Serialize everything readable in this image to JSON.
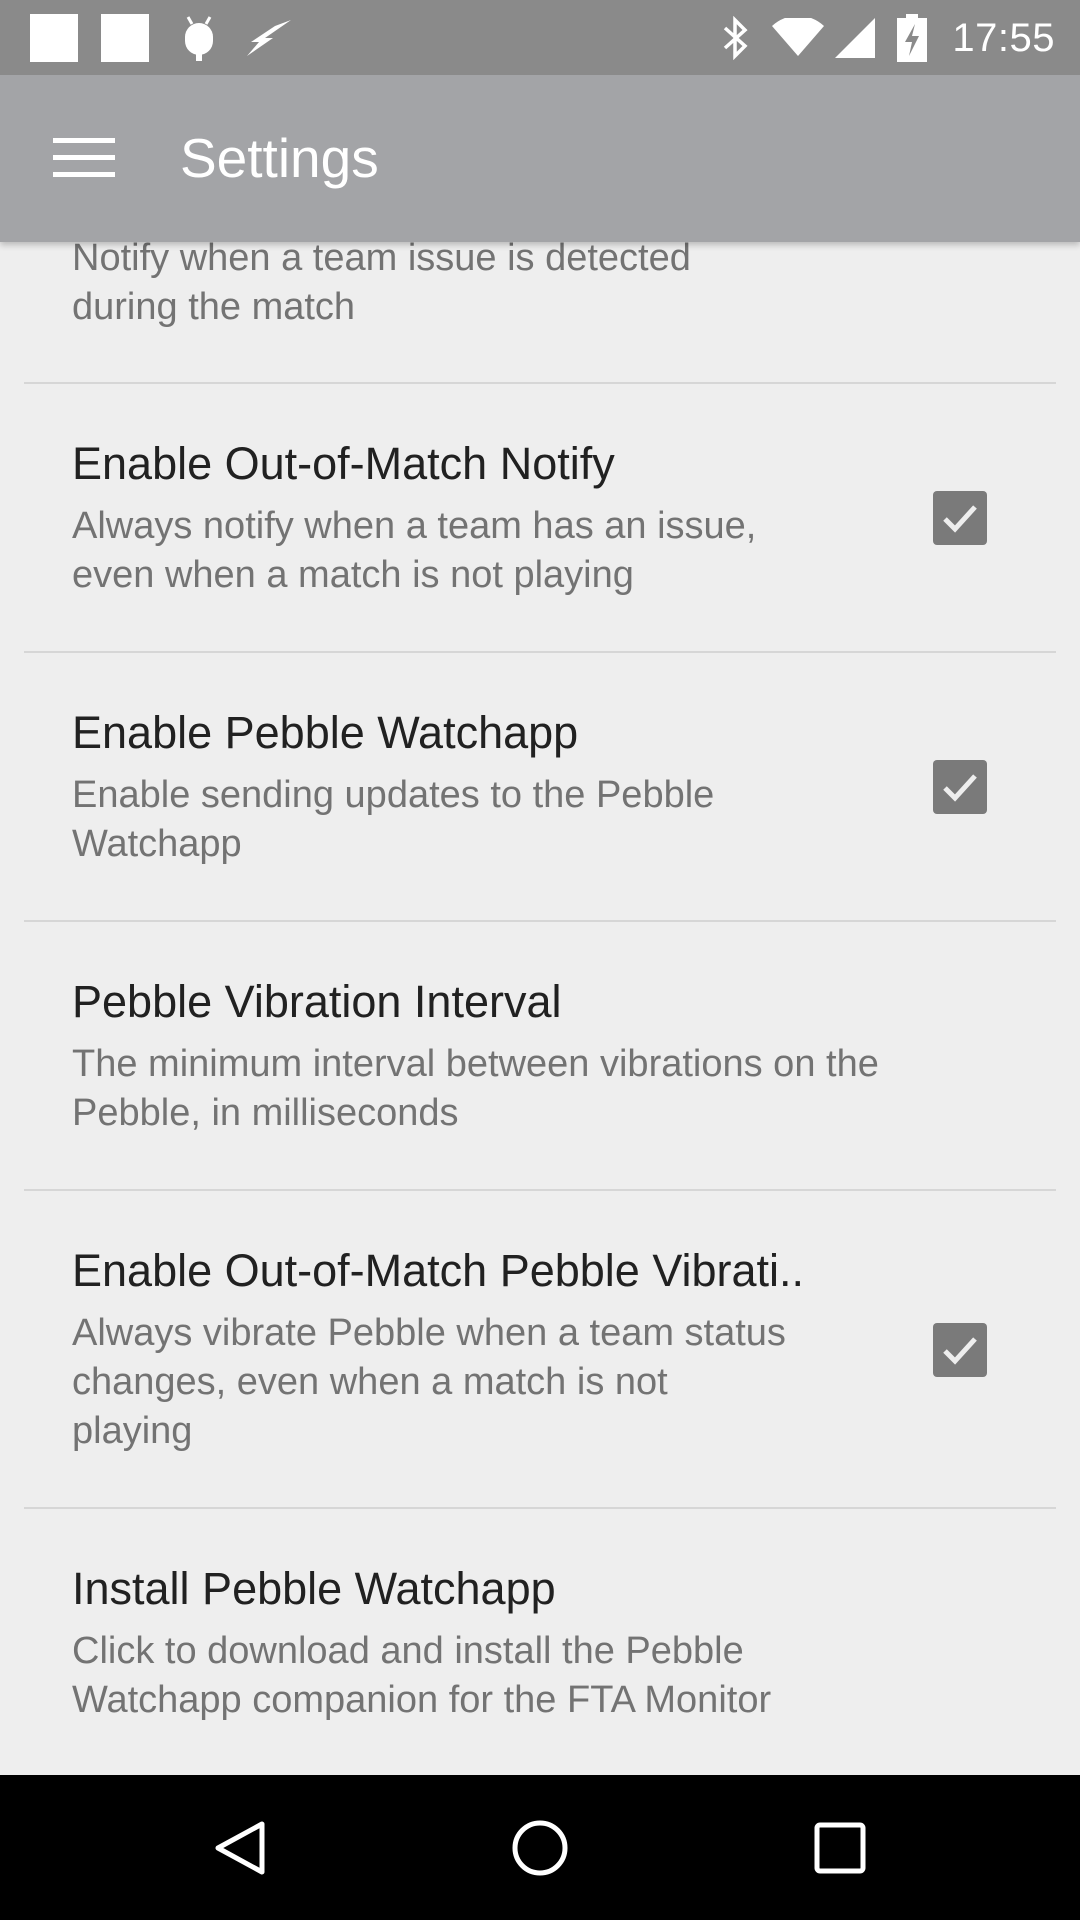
{
  "status_bar": {
    "time": "17:55",
    "left_icons": [
      "notification-square-icon",
      "notification-square-icon",
      "android-debug-icon",
      "lightning-icon"
    ],
    "right_icons": [
      "bluetooth-icon",
      "wifi-icon",
      "cellular-signal-icon",
      "battery-charging-icon"
    ]
  },
  "app_bar": {
    "title": "Settings",
    "menu_icon": "hamburger-menu-icon"
  },
  "preferences": [
    {
      "title": "",
      "summary_lines": [
        "Notify when a team issue is detected",
        "during the match"
      ],
      "checkbox": true,
      "checked": true
    },
    {
      "title": "Enable Out-of-Match Notify",
      "summary_lines": [
        "Always notify when a team has an issue,",
        "even when a match is not playing"
      ],
      "checkbox": true,
      "checked": true
    },
    {
      "title": "Enable Pebble Watchapp",
      "summary_lines": [
        "Enable sending updates to the Pebble",
        "Watchapp"
      ],
      "checkbox": true,
      "checked": true
    },
    {
      "title": "Pebble Vibration Interval",
      "summary_lines": [
        "The minimum interval between vibrations on the",
        "Pebble, in milliseconds"
      ],
      "checkbox": false
    },
    {
      "title": "Enable Out-of-Match Pebble Vibrati..",
      "summary_lines": [
        "Always vibrate Pebble when a team status",
        "changes, even when a match is not",
        "playing"
      ],
      "checkbox": true,
      "checked": true
    },
    {
      "title": "Install Pebble Watchapp",
      "summary_lines": [
        "Click to download and install the Pebble",
        "Watchapp companion for the FTA Monitor"
      ],
      "checkbox": false
    }
  ],
  "nav_bar": {
    "back_icon": "back-triangle-icon",
    "home_icon": "home-circle-icon",
    "recents_icon": "recents-square-icon"
  },
  "colors": {
    "status_bar": "#8a8a8a",
    "app_bar": "#a3a4a7",
    "background": "#eeeeee",
    "checkbox": "#7a7a7a",
    "title_text": "#212121",
    "summary_text": "#737373"
  }
}
